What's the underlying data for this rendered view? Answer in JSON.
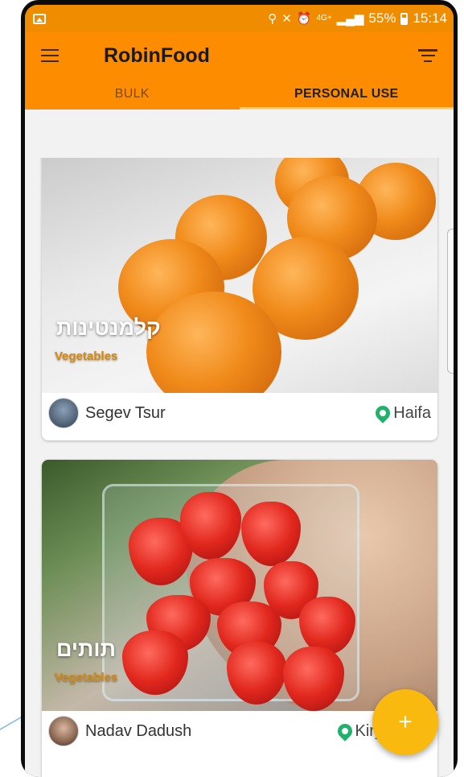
{
  "status_bar": {
    "network": "4G+",
    "battery": "55%",
    "time": "15:14"
  },
  "app": {
    "title": "RobinFood"
  },
  "tabs": [
    {
      "label": "BULK",
      "active": false
    },
    {
      "label": "PERSONAL USE",
      "active": true
    }
  ],
  "items": [
    {
      "title": "קלמנטינות",
      "category": "Vegetables",
      "user": "Segev Tsur",
      "location": "Haifa"
    },
    {
      "title": "תותים",
      "category": "Vegetables",
      "user": "Nadav Dadush",
      "location": "Kiryat Ono"
    }
  ],
  "fab": {
    "symbol": "+"
  },
  "colors": {
    "primary": "#fe8c00",
    "status_bar": "#f08c00",
    "accent": "#f9b90f",
    "tab_indicator": "#ffd36a",
    "pin": "#20b26a",
    "category_text": "#d88a10"
  },
  "icons": {
    "menu": "hamburger-icon",
    "filter": "filter-icon",
    "location": "location-pin-icon"
  }
}
